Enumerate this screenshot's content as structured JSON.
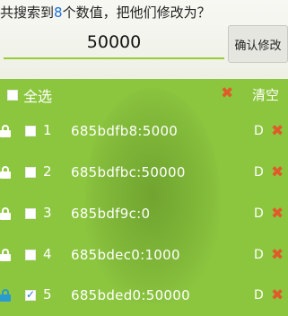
{
  "header": {
    "prompt_pre": "共搜索到",
    "count": "8",
    "prompt_post": "个数值，把他们修改为？",
    "input_value": "50000",
    "confirm_label": "确认修改"
  },
  "list": {
    "select_all_label": "全选",
    "clear_label": "清空",
    "rows": [
      {
        "index": "1",
        "entry": "685bdfb8:5000",
        "tag": "D",
        "checked": false
      },
      {
        "index": "2",
        "entry": "685bdfbc:50000",
        "tag": "D",
        "checked": false
      },
      {
        "index": "3",
        "entry": "685bdf9c:0",
        "tag": "D",
        "checked": false
      },
      {
        "index": "4",
        "entry": "685bdec0:1000",
        "tag": "D",
        "checked": false
      },
      {
        "index": "5",
        "entry": "685bded0:50000",
        "tag": "D",
        "checked": true
      }
    ]
  },
  "icons": {
    "lock": "lock-icon",
    "delete": "delete-x-icon",
    "clear": "clear-x-icon"
  },
  "colors": {
    "panel": "#8cc63f",
    "count": "#1e6fd9",
    "delete": "#e05a2a",
    "check": "#2a78d0"
  }
}
